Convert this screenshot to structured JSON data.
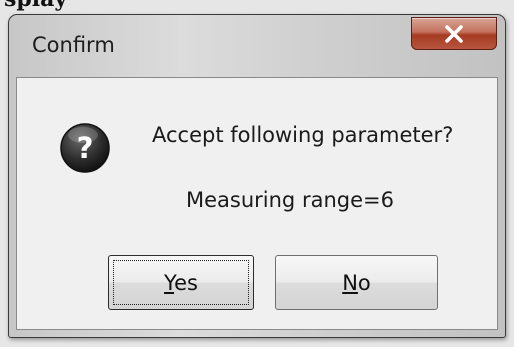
{
  "page_fragment": "splay",
  "dialog": {
    "title": "Confirm",
    "close_icon": "close-x-icon",
    "message_icon": "question-mark-icon",
    "prompt": "Accept following parameter?",
    "parameter": "Measuring range=6",
    "buttons": {
      "yes_label": "Yes",
      "no_label": "No"
    },
    "colors": {
      "close_button": "#b8563e",
      "icon_fill": "#2c2c2c"
    }
  }
}
